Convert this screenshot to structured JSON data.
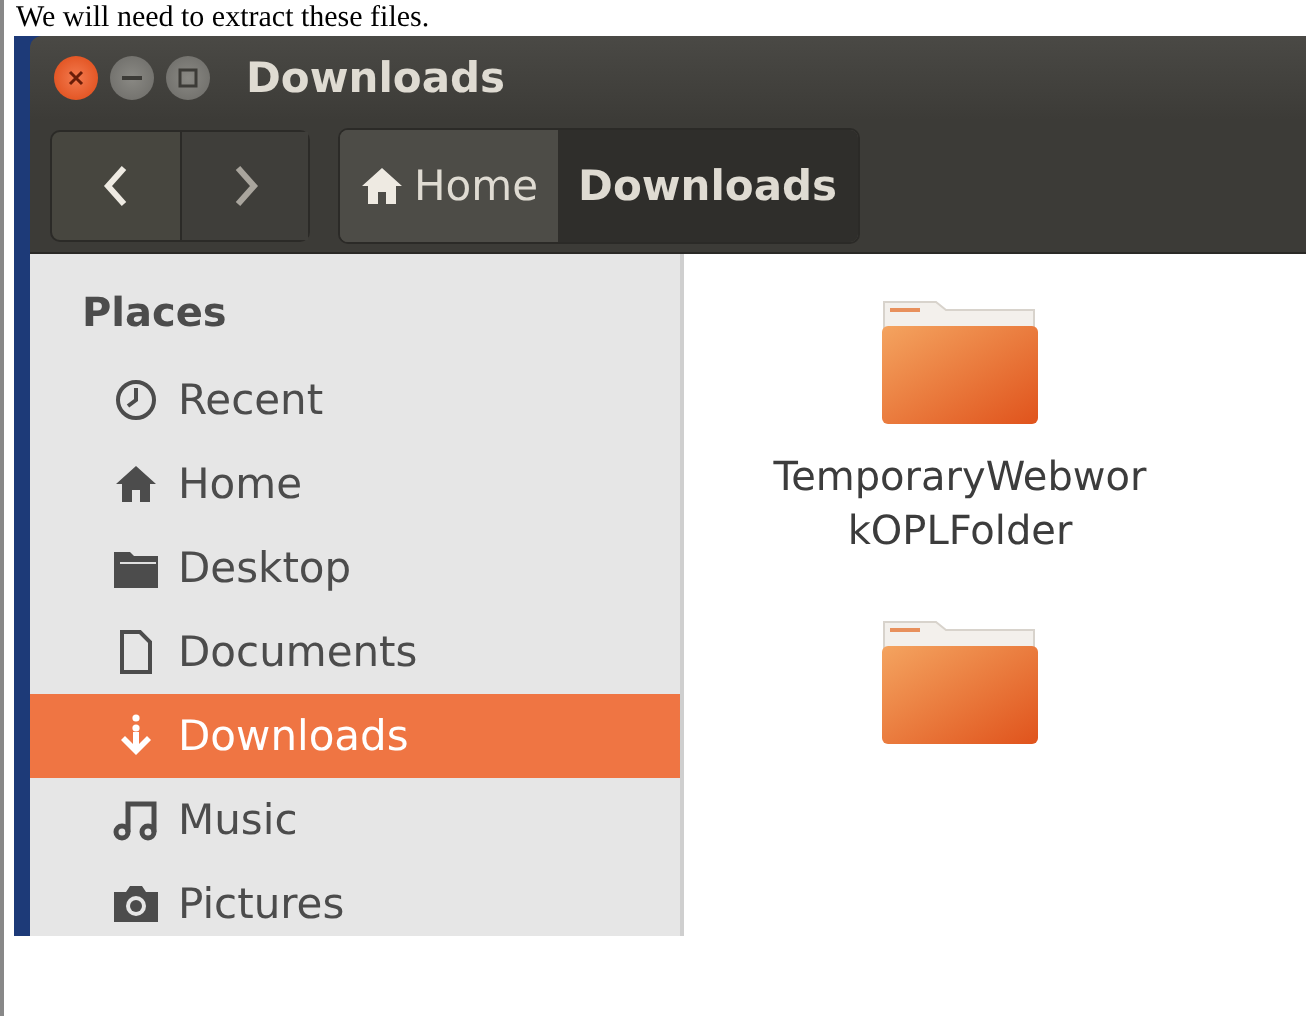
{
  "caption": "We will need to extract these files.",
  "window": {
    "title": "Downloads"
  },
  "breadcrumbs": [
    {
      "label": "Home",
      "kind": "home",
      "selected": false
    },
    {
      "label": "Downloads",
      "kind": "plain",
      "selected": true
    }
  ],
  "sidebar": {
    "heading": "Places",
    "items": [
      {
        "label": "Recent",
        "kind": "recent",
        "selected": false
      },
      {
        "label": "Home",
        "kind": "home",
        "selected": false
      },
      {
        "label": "Desktop",
        "kind": "desktop",
        "selected": false
      },
      {
        "label": "Documents",
        "kind": "documents",
        "selected": false
      },
      {
        "label": "Downloads",
        "kind": "downloads",
        "selected": true
      },
      {
        "label": "Music",
        "kind": "music",
        "selected": false
      },
      {
        "label": "Pictures",
        "kind": "pictures",
        "selected": false
      }
    ]
  },
  "files": [
    {
      "name": "TemporaryWebwor\nkOPLFolder",
      "kind": "folder"
    },
    {
      "kind": "folder"
    }
  ]
}
